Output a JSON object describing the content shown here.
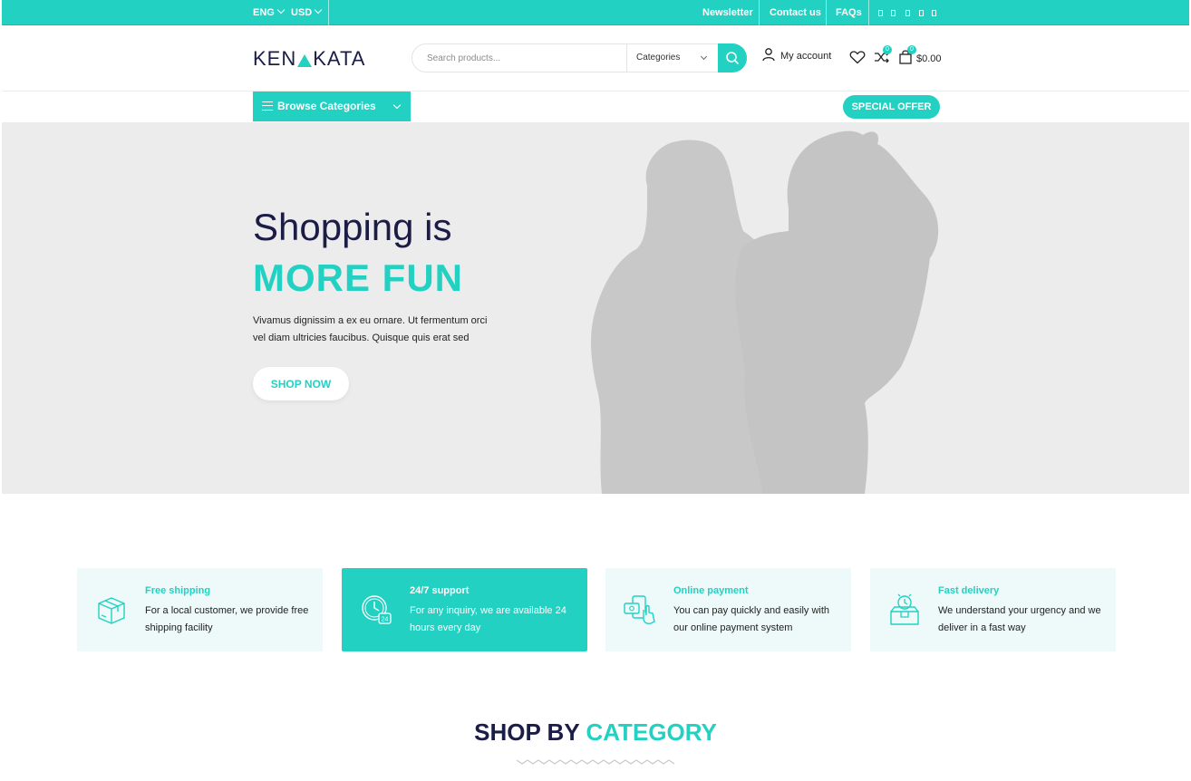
{
  "topbar": {
    "language": "ENG",
    "currency": "USD",
    "links": [
      "Newsletter",
      "Contact us",
      "FAQs"
    ]
  },
  "header": {
    "logo_left": "KEN",
    "logo_right": "KATA",
    "search_placeholder": "Search products...",
    "categories_label": "Categories",
    "account_label": "My account",
    "compare_count": "0",
    "cart_count": "0",
    "cart_total": "$0.00"
  },
  "nav": {
    "browse_label": "Browse Categories",
    "special_offer_label": "SPECIAL OFFER"
  },
  "hero": {
    "title_line1": "Shopping is",
    "title_line2": "MORE FUN",
    "description": "Vivamus dignissim a ex eu ornare. Ut fermentum orci vel diam ultricies faucibus. Quisque quis erat sed",
    "cta_label": "SHOP NOW"
  },
  "features": [
    {
      "title": "Free shipping",
      "description": "For a local customer, we provide free shipping facility",
      "icon": "box-icon"
    },
    {
      "title": "24/7 support",
      "description": "For any inquiry, we are available 24 hours every day",
      "icon": "clock-24-icon"
    },
    {
      "title": "Online payment",
      "description": "You can pay quickly and easily with our online payment system",
      "icon": "payment-icon"
    },
    {
      "title": "Fast delivery",
      "description": "We understand your urgency and we deliver in a fast way",
      "icon": "fast-delivery-icon"
    }
  ],
  "section": {
    "title_part1": "SHOP BY",
    "title_part2": "CATEGORY"
  },
  "colors": {
    "accent": "#22d1c2",
    "navy": "#1b1d46",
    "hero_bg": "#ececec",
    "feature_bg": "#edfaf9"
  }
}
